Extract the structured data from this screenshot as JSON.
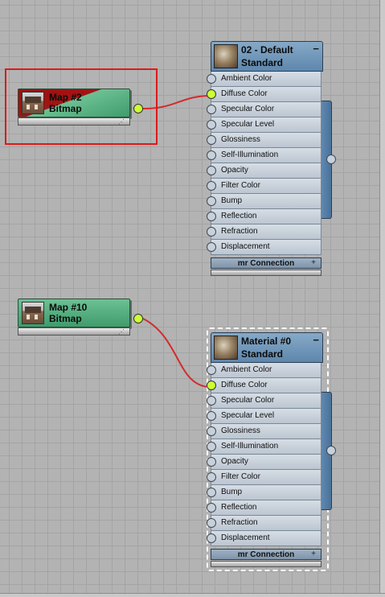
{
  "map_nodes": [
    {
      "id": "map2",
      "title": "Map #2",
      "subtitle": "Bitmap",
      "selected": true,
      "thumbnail": "house-photo-icon"
    },
    {
      "id": "map10",
      "title": "Map #10",
      "subtitle": "Bitmap",
      "selected": false,
      "thumbnail": "house-photo-icon"
    }
  ],
  "material_nodes": [
    {
      "id": "mat-default",
      "title": "02 - Default",
      "type": "Standard",
      "collapse": "−",
      "footer": "mr Connection",
      "footer_expand": "+",
      "slots": [
        "Ambient Color",
        "Diffuse Color",
        "Specular Color",
        "Specular Level",
        "Glossiness",
        "Self-Illumination",
        "Opacity",
        "Filter Color",
        "Bump",
        "Reflection",
        "Refraction",
        "Displacement"
      ],
      "connected_slot": "Diffuse Color",
      "selected": false
    },
    {
      "id": "mat-0",
      "title": "Material #0",
      "type": "Standard",
      "collapse": "−",
      "footer": "mr Connection",
      "footer_expand": "+",
      "slots": [
        "Ambient Color",
        "Diffuse Color",
        "Specular Color",
        "Specular Level",
        "Glossiness",
        "Self-Illumination",
        "Opacity",
        "Filter Color",
        "Bump",
        "Reflection",
        "Refraction",
        "Displacement"
      ],
      "connected_slot": "Diffuse Color",
      "selected": true
    }
  ],
  "colors": {
    "wire": "#d42b2b",
    "active_socket": "#ccff33",
    "map_node": "#55b080",
    "material_header": "#6f97bb",
    "selection": "#e01818"
  }
}
